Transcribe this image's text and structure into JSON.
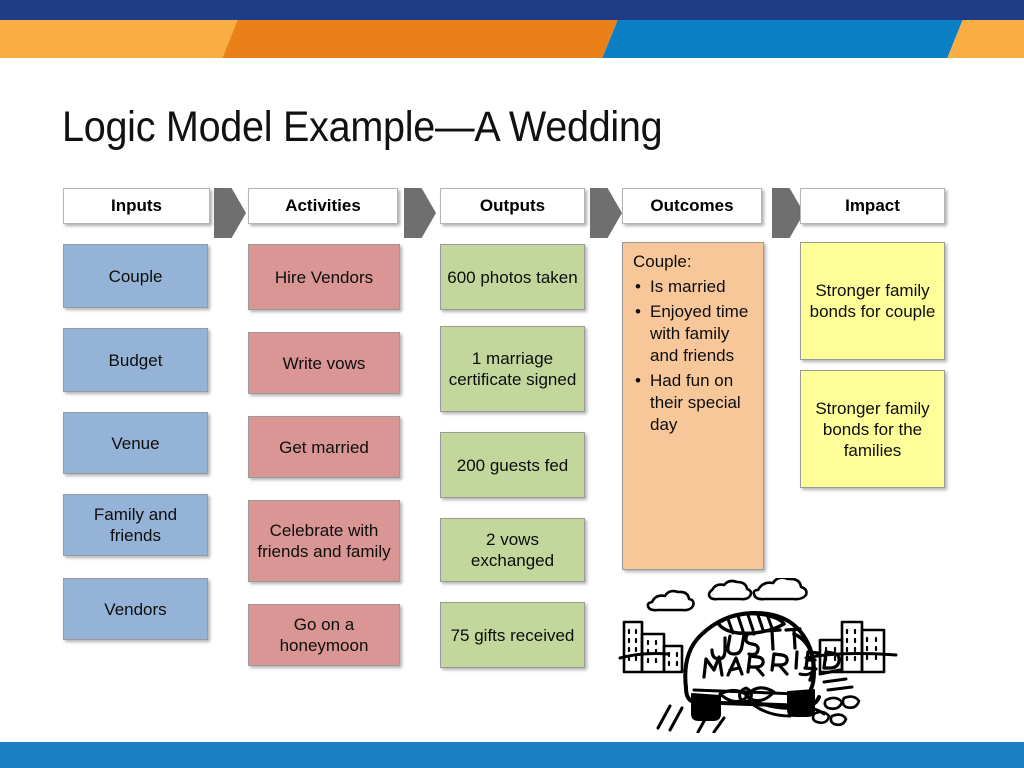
{
  "slide": {
    "title": "Logic Model Example—A Wedding"
  },
  "theme": {
    "navy": "#1f3c87",
    "orange_light": "#f9ad43",
    "orange_dark": "#ea8018",
    "blue_accent": "#0b7fc4",
    "footer_blue": "#1b80c4",
    "cell_blue": "#95b3d7",
    "cell_pink": "#d99694",
    "cell_green": "#c3d69b",
    "cell_peach": "#f7c799",
    "cell_yellow": "#ffff99",
    "arrow_gray": "#6f6f6f"
  },
  "diagram": {
    "columns": [
      {
        "key": "inputs",
        "header": "Inputs",
        "color": "blue",
        "cells": [
          "Couple",
          "Budget",
          "Venue",
          "Family and friends",
          "Vendors"
        ]
      },
      {
        "key": "activities",
        "header": "Activities",
        "color": "pink",
        "cells": [
          "Hire Vendors",
          "Write vows",
          "Get married",
          "Celebrate with friends and family",
          "Go on a honeymoon"
        ]
      },
      {
        "key": "outputs",
        "header": "Outputs",
        "color": "green",
        "cells": [
          "600 photos taken",
          "1 marriage certificate signed",
          "200 guests fed",
          "2 vows exchanged",
          "75 gifts received"
        ]
      },
      {
        "key": "outcomes",
        "header": "Outcomes",
        "color": "peach",
        "panel": {
          "heading": "Couple:",
          "bullets": [
            "Is married",
            "Enjoyed time with family and friends",
            "Had fun on their special day"
          ]
        }
      },
      {
        "key": "impact",
        "header": "Impact",
        "color": "yellow",
        "cells": [
          "Stronger family bonds for couple",
          "Stronger family bonds for the families"
        ]
      }
    ]
  },
  "clipart": {
    "name": "just-married-car",
    "text_line_1": "JUST",
    "text_line_2": "MARRIED"
  }
}
